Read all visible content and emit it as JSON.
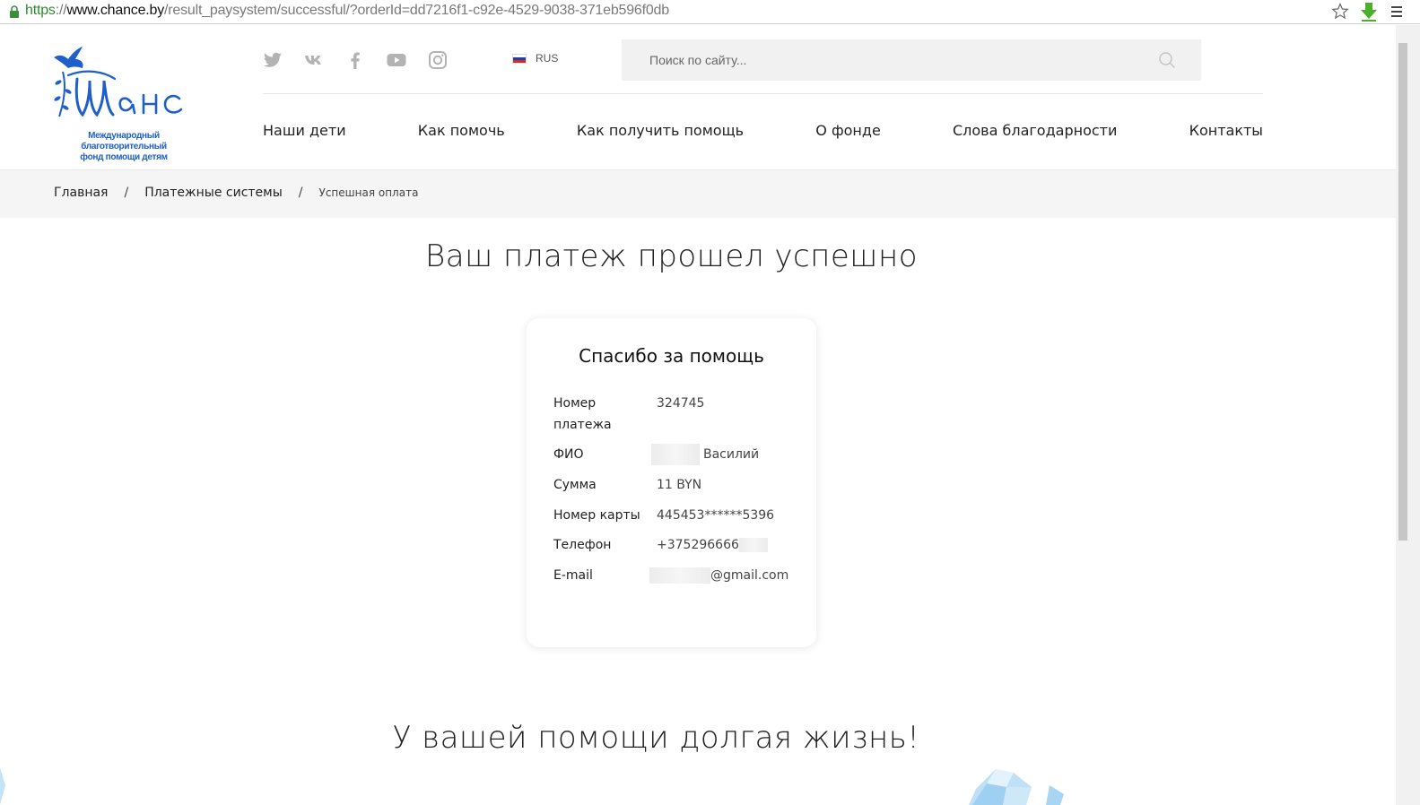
{
  "browser": {
    "url_scheme": "https",
    "url_sep": "://",
    "url_host": "www.chance.by",
    "url_path": "/result_paysystem/successful/?orderId=dd7216f1-c92e-4529-9038-371eb596f0db",
    "icons": [
      "lock-icon",
      "star-icon",
      "download-icon",
      "menu-icon"
    ]
  },
  "logo": {
    "name": "Шанс",
    "tagline_line1": "Международный благотворительный",
    "tagline_line2": "фонд помощи детям",
    "color": "#1e5fc8"
  },
  "socials": [
    "twitter-icon",
    "vk-icon",
    "facebook-icon",
    "youtube-icon",
    "instagram-icon"
  ],
  "lang": {
    "code": "RUS"
  },
  "search": {
    "placeholder": "Поиск по сайту..."
  },
  "nav": {
    "items": [
      "Наши дети",
      "Как помочь",
      "Как получить помощь",
      "О фонде",
      "Слова благодарности",
      "Контакты"
    ]
  },
  "breadcrumb": {
    "home": "Главная",
    "parent": "Платежные системы",
    "current": "Успешная оплата",
    "separator": "/"
  },
  "main": {
    "title": "Ваш платеж прошел успешно",
    "subtitle": "У вашей помощи долгая жизнь!"
  },
  "card": {
    "title": "Спасибо за помощь",
    "rows": [
      {
        "label_line1": "Номер",
        "label_line2": "платежа",
        "value": "324745"
      },
      {
        "label": "ФИО",
        "value": "Василий"
      },
      {
        "label": "Сумма",
        "value": "11 BYN"
      },
      {
        "label": "Номер карты",
        "value": "445453******5396"
      },
      {
        "label": "Телефон",
        "value": "+375296666"
      },
      {
        "label": "E-mail",
        "value": "@gmail.com"
      }
    ]
  }
}
